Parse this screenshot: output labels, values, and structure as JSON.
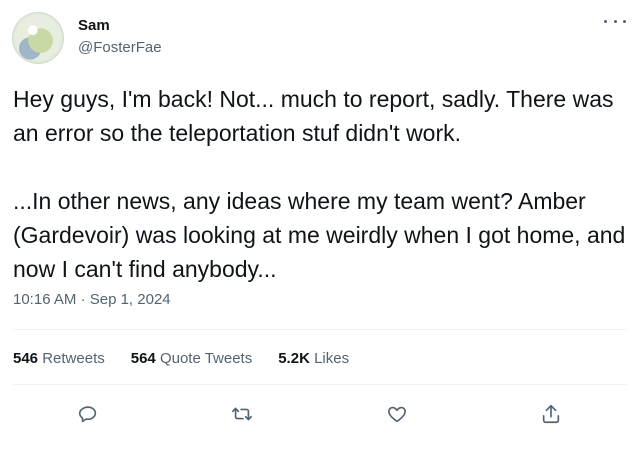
{
  "author": {
    "name": "Sam",
    "handle": "@FosterFae"
  },
  "tweet": {
    "paragraphs": [
      "Hey guys, I'm back! Not... much to report, sadly. There was an error so the teleportation stuf didn't work.",
      "...In other news, any ideas where my team went? Amber (Gardevoir) was looking at me weirdly when I got home, and now I can't find anybody..."
    ],
    "time": "10:16 AM",
    "separator": "·",
    "date": "Sep 1, 2024"
  },
  "stats": {
    "retweets": {
      "count": "546",
      "label": "Retweets"
    },
    "quotes": {
      "count": "564",
      "label": "Quote Tweets"
    },
    "likes": {
      "count": "5.2K",
      "label": "Likes"
    }
  },
  "actions": [
    {
      "icon": "reply-icon"
    },
    {
      "icon": "retweet-icon"
    },
    {
      "icon": "like-icon"
    },
    {
      "icon": "share-icon"
    }
  ],
  "colors": {
    "text": "#0f1419",
    "secondary": "#536471",
    "divider": "#eff3f4"
  }
}
